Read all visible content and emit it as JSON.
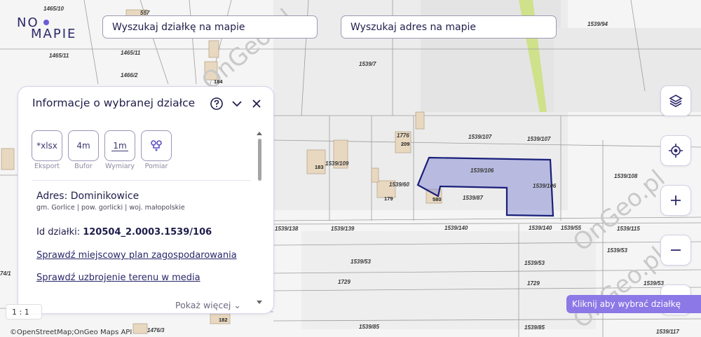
{
  "logo": {
    "line1": "NO",
    "line2": "MAPIE"
  },
  "search": {
    "plot_placeholder": "Wyszukaj działkę na mapie",
    "address_placeholder": "Wyszukaj adres na mapie"
  },
  "panel": {
    "title": "Informacje o wybranej działce",
    "tools": [
      {
        "icon_text": "*xlsx",
        "label": "Eksport"
      },
      {
        "icon_text": "4m",
        "label": "Bufor"
      },
      {
        "icon_text": "1m",
        "label": "Wymiary"
      },
      {
        "icon_text": "",
        "label": "Pomiar"
      }
    ],
    "address_label": "Adres: Dominikowice",
    "address_sub": "gm. Gorlice | pow. gorlicki | woj. małopolskie",
    "parcel_id_label": "Id działki: ",
    "parcel_id_value": "120504_2.0003.1539/106",
    "link_plan": "Sprawdź miejscowy plan zagospodarowania",
    "link_media": "Sprawdź uzbrojenie terenu w media",
    "show_more": "Pokaż więcej"
  },
  "map": {
    "scale_text": "1 : 1",
    "attribution": "©OpenStreetMap;OnGeo Maps API",
    "hint": "Kliknij aby wybrać działkę",
    "watermark": "OnGeo.pl",
    "selected_parcel_color": "#8e93d6",
    "road_green_color": "#cfe18a",
    "parcel_labels": [
      "1465/10",
      "1465/11",
      "1465/11",
      "1466/2",
      "557",
      "1539/7",
      "1539/94",
      "1776",
      "1539/107",
      "1539/107",
      "1539/109",
      "1539/106",
      "1539/106",
      "1539/108",
      "1539/60",
      "1539/87",
      "1539/138",
      "1539/139",
      "1539/140",
      "1539/140",
      "1539/55",
      "1539/115",
      "1539/53",
      "1539/53",
      "1539/53",
      "1729",
      "1729",
      "1539/53",
      "1539/85",
      "1539/85",
      "1539/117",
      "1476/3",
      "74/1"
    ],
    "house_numbers": [
      "184",
      "209",
      "183",
      "179",
      "580",
      "182"
    ]
  }
}
